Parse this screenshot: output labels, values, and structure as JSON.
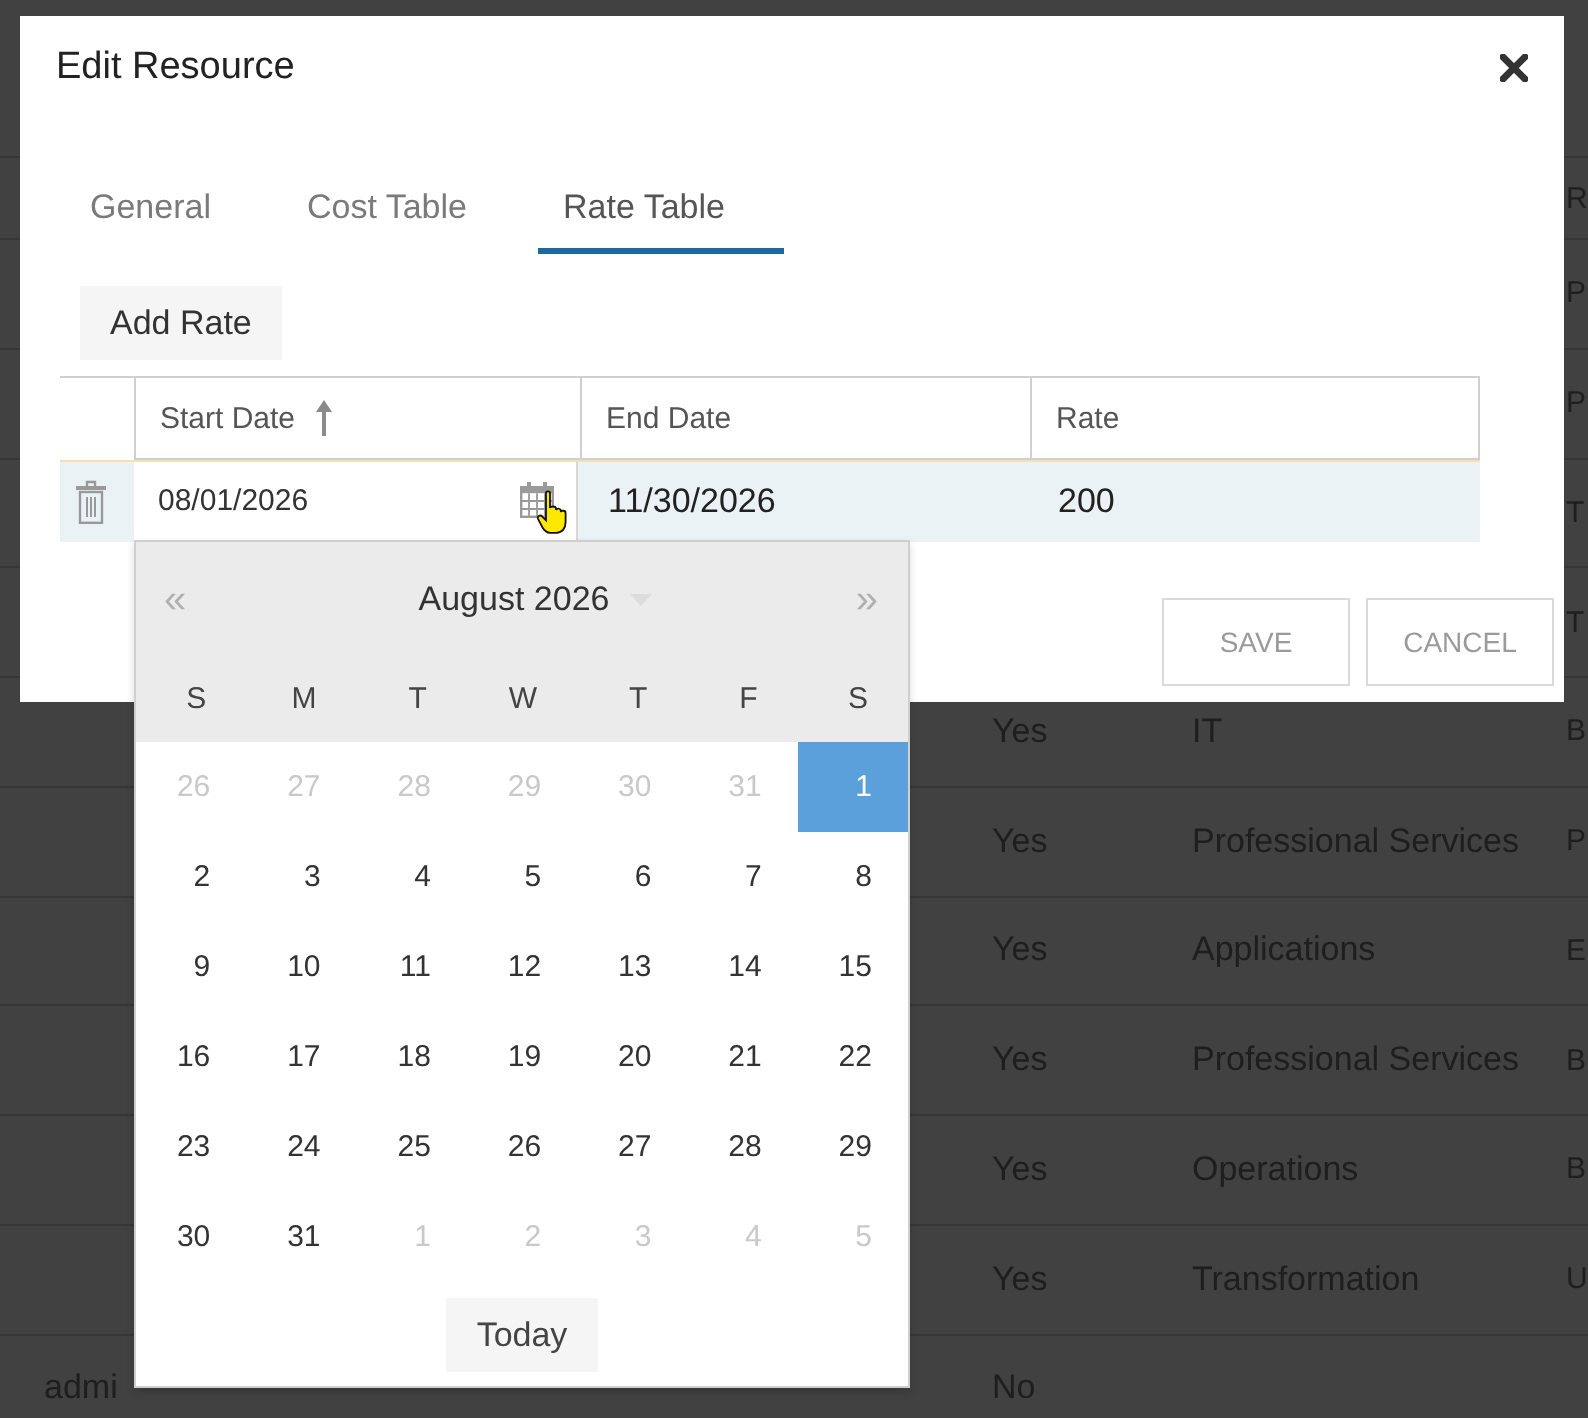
{
  "background_table": {
    "header": {
      "column_4": "R"
    },
    "rows": [
      {
        "column_4": "P"
      },
      {
        "column_4": "P"
      },
      {
        "column_4": "T"
      },
      {
        "column_4": "T"
      },
      {
        "column_2": "Yes",
        "column_3": "IT",
        "column_4": "B"
      },
      {
        "column_2": "Yes",
        "column_3": "Professional Services",
        "column_4": "P"
      },
      {
        "column_2": "Yes",
        "column_3": "Applications",
        "column_4": "E"
      },
      {
        "column_2": "Yes",
        "column_3": "Professional Services",
        "column_4": "B"
      },
      {
        "column_2": "Yes",
        "column_3": "Operations",
        "column_4": "B"
      },
      {
        "column_2": "Yes",
        "column_3": "Transformation",
        "column_4": "U"
      },
      {
        "column_1": "admi",
        "column_2": "No"
      }
    ]
  },
  "dialog": {
    "title": "Edit Resource",
    "tabs": [
      {
        "label": "General",
        "selected": false
      },
      {
        "label": "Cost Table",
        "selected": false
      },
      {
        "label": "Rate Table",
        "selected": true
      }
    ],
    "add_button": "Add Rate",
    "grid": {
      "columns": [
        {
          "label": "Start Date",
          "sorted": true
        },
        {
          "label": "End Date",
          "sorted": false
        },
        {
          "label": "Rate",
          "sorted": false
        }
      ],
      "rows": [
        {
          "selected": true,
          "cells": [
            {
              "value": "08/01/2026",
              "editing": true
            },
            {
              "value": "11/30/2026",
              "editing": false
            },
            {
              "value": "200",
              "editing": false
            }
          ]
        }
      ]
    },
    "date_picker": {
      "prev": "«",
      "title": "August 2026",
      "next": "»",
      "weekdays": [
        "S",
        "M",
        "T",
        "W",
        "T",
        "F",
        "S"
      ],
      "weeks": [
        [
          {
            "day": "26",
            "other_month": true,
            "selected": false
          },
          {
            "day": "27",
            "other_month": true,
            "selected": false
          },
          {
            "day": "28",
            "other_month": true,
            "selected": false
          },
          {
            "day": "29",
            "other_month": true,
            "selected": false
          },
          {
            "day": "30",
            "other_month": true,
            "selected": false
          },
          {
            "day": "31",
            "other_month": true,
            "selected": false
          },
          {
            "day": "1",
            "other_month": false,
            "selected": true
          }
        ],
        [
          {
            "day": "2",
            "other_month": false,
            "selected": false
          },
          {
            "day": "3",
            "other_month": false,
            "selected": false
          },
          {
            "day": "4",
            "other_month": false,
            "selected": false
          },
          {
            "day": "5",
            "other_month": false,
            "selected": false
          },
          {
            "day": "6",
            "other_month": false,
            "selected": false
          },
          {
            "day": "7",
            "other_month": false,
            "selected": false
          },
          {
            "day": "8",
            "other_month": false,
            "selected": false
          }
        ],
        [
          {
            "day": "9",
            "other_month": false,
            "selected": false
          },
          {
            "day": "10",
            "other_month": false,
            "selected": false
          },
          {
            "day": "11",
            "other_month": false,
            "selected": false
          },
          {
            "day": "12",
            "other_month": false,
            "selected": false
          },
          {
            "day": "13",
            "other_month": false,
            "selected": false
          },
          {
            "day": "14",
            "other_month": false,
            "selected": false
          },
          {
            "day": "15",
            "other_month": false,
            "selected": false
          }
        ],
        [
          {
            "day": "16",
            "other_month": false,
            "selected": false
          },
          {
            "day": "17",
            "other_month": false,
            "selected": false
          },
          {
            "day": "18",
            "other_month": false,
            "selected": false
          },
          {
            "day": "19",
            "other_month": false,
            "selected": false
          },
          {
            "day": "20",
            "other_month": false,
            "selected": false
          },
          {
            "day": "21",
            "other_month": false,
            "selected": false
          },
          {
            "day": "22",
            "other_month": false,
            "selected": false
          }
        ],
        [
          {
            "day": "23",
            "other_month": false,
            "selected": false
          },
          {
            "day": "24",
            "other_month": false,
            "selected": false
          },
          {
            "day": "25",
            "other_month": false,
            "selected": false
          },
          {
            "day": "26",
            "other_month": false,
            "selected": false
          },
          {
            "day": "27",
            "other_month": false,
            "selected": false
          },
          {
            "day": "28",
            "other_month": false,
            "selected": false
          },
          {
            "day": "29",
            "other_month": false,
            "selected": false
          }
        ],
        [
          {
            "day": "30",
            "other_month": false,
            "selected": false
          },
          {
            "day": "31",
            "other_month": false,
            "selected": false
          },
          {
            "day": "1",
            "other_month": true,
            "selected": false
          },
          {
            "day": "2",
            "other_month": true,
            "selected": false
          },
          {
            "day": "3",
            "other_month": true,
            "selected": false
          },
          {
            "day": "4",
            "other_month": true,
            "selected": false
          },
          {
            "day": "5",
            "other_month": true,
            "selected": false
          }
        ]
      ],
      "today_button": "Today"
    },
    "footer_buttons": [
      "SAVE",
      "CANCEL"
    ]
  }
}
